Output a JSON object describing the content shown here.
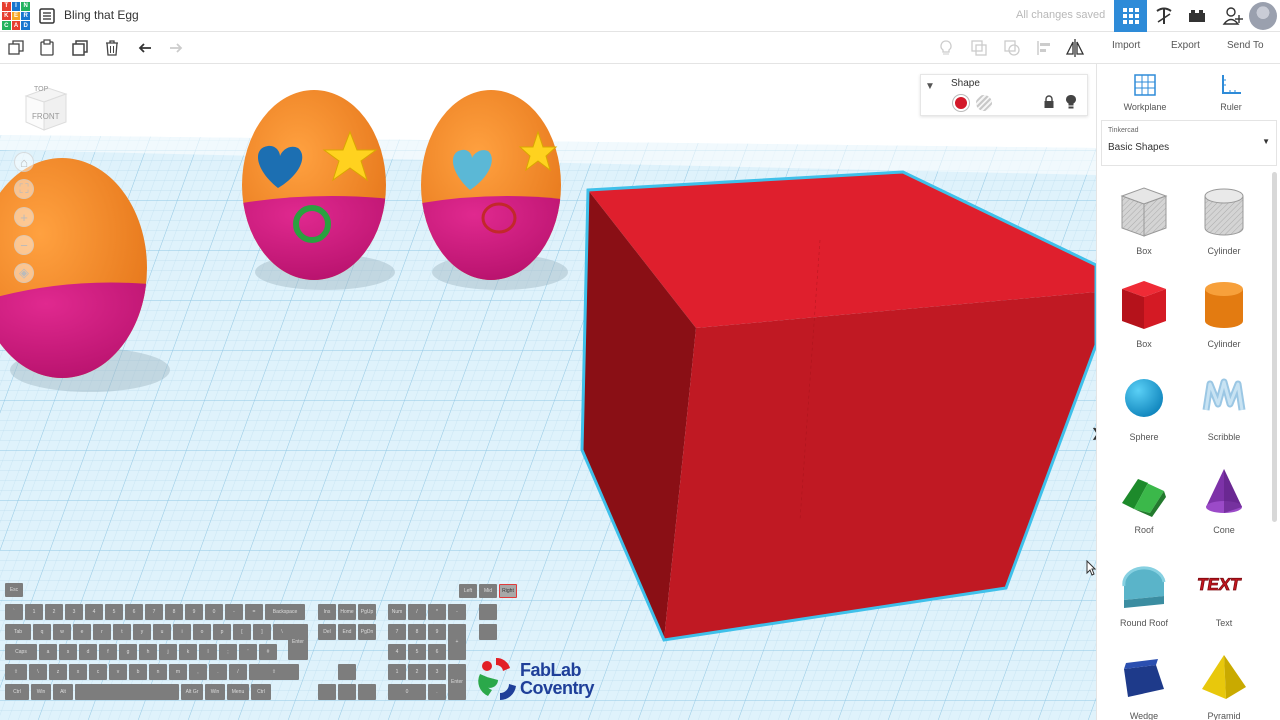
{
  "app": {
    "logo_letters": [
      "T",
      "I",
      "N",
      "K",
      "E",
      "R",
      "C",
      "A",
      "D"
    ],
    "logo_colors": [
      "#e63e2f",
      "#1877cf",
      "#23b35f",
      "#e63e2f",
      "#f5a623",
      "#1877cf",
      "#23b35f",
      "#e63e2f",
      "#1877cf"
    ],
    "title": "Bling that Egg",
    "save_status": "All changes saved",
    "accent": "#2e8bd8"
  },
  "toolbar": {
    "import_label": "Import",
    "export_label": "Export",
    "send_to_label": "Send To"
  },
  "viewcube": {
    "top_label": "TOP",
    "front_label": "FRONT"
  },
  "inspector": {
    "title": "Shape",
    "solid_color": "#d3192a"
  },
  "panel": {
    "workplane_label": "Workplane",
    "ruler_label": "Ruler",
    "library_caption": "Tinkercad",
    "library_value": "Basic Shapes",
    "shapes": [
      {
        "label": "Box",
        "kind": "box-hole"
      },
      {
        "label": "Cylinder",
        "kind": "cylinder-hole"
      },
      {
        "label": "Box",
        "kind": "box"
      },
      {
        "label": "Cylinder",
        "kind": "cylinder"
      },
      {
        "label": "Sphere",
        "kind": "sphere"
      },
      {
        "label": "Scribble",
        "kind": "scribble"
      },
      {
        "label": "Roof",
        "kind": "roof"
      },
      {
        "label": "Cone",
        "kind": "cone"
      },
      {
        "label": "Round Roof",
        "kind": "round-roof"
      },
      {
        "label": "Text",
        "kind": "text"
      },
      {
        "label": "Wedge",
        "kind": "wedge"
      },
      {
        "label": "Pyramid",
        "kind": "pyramid"
      }
    ],
    "text_shape_glyph": "TEXT"
  },
  "keyboard": {
    "esc": "Esc",
    "mouse": [
      "Left",
      "Mid",
      "Right"
    ],
    "row1": [
      "`",
      "1",
      "2",
      "3",
      "4",
      "5",
      "6",
      "7",
      "8",
      "9",
      "0",
      "-",
      "=",
      "Backspace"
    ],
    "row2": [
      "Tab",
      "q",
      "w",
      "e",
      "r",
      "t",
      "y",
      "u",
      "i",
      "o",
      "p",
      "[",
      "]",
      "\\"
    ],
    "row3": [
      "Caps",
      "a",
      "s",
      "d",
      "f",
      "g",
      "h",
      "j",
      "k",
      "l",
      ";",
      "'",
      "#"
    ],
    "row4": [
      "⇧",
      "\\",
      "z",
      "x",
      "c",
      "v",
      "b",
      "n",
      "m",
      ",",
      ".",
      "/",
      "⇧"
    ],
    "row5": [
      "Ctrl",
      "Win",
      "Alt",
      "",
      "Alt Gr",
      "Win",
      "Menu",
      "Ctrl"
    ],
    "nav1": [
      "Ins",
      "Home",
      "PgUp"
    ],
    "nav2": [
      "Del",
      "End",
      "PgDn"
    ],
    "numpad": [
      "Num",
      "/",
      "*",
      "-",
      "7",
      "8",
      "9",
      "+",
      "4",
      "5",
      "6",
      "1",
      "2",
      "3",
      "Enter",
      "0",
      "."
    ],
    "enter": "Enter"
  },
  "watermark": {
    "line1": "FabLab",
    "line2": "Coventry"
  }
}
